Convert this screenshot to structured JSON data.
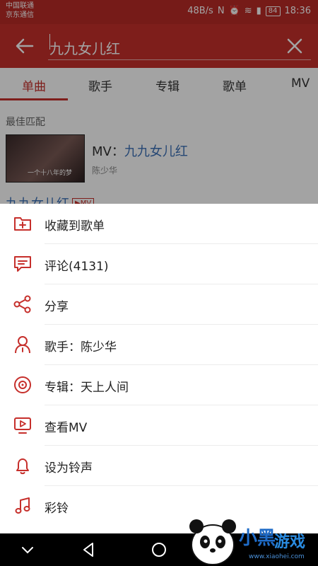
{
  "status_bar": {
    "carrier_1": "中国联通",
    "carrier_2": "京东通信",
    "network_speed": "48B/s",
    "battery": "84",
    "time": "18:36"
  },
  "search": {
    "query": "九九女儿红"
  },
  "tabs": [
    {
      "label": "单曲",
      "active": true
    },
    {
      "label": "歌手",
      "active": false
    },
    {
      "label": "专辑",
      "active": false
    },
    {
      "label": "歌单",
      "active": false
    },
    {
      "label": "MV",
      "active": false
    }
  ],
  "results": {
    "best_match_label": "最佳匹配",
    "thumbnail_caption": "一个十八年的梦",
    "mv_prefix": "MV：",
    "mv_title": "九九女儿红",
    "mv_artist": "陈少华",
    "song_title": "九九女儿红",
    "song_badge": "▶MV"
  },
  "menu": [
    {
      "label": "收藏到歌单",
      "icon": "folder-add-icon"
    },
    {
      "label": "评论(4131)",
      "icon": "comment-icon"
    },
    {
      "label": "分享",
      "icon": "share-icon"
    },
    {
      "label": "歌手：陈少华",
      "icon": "artist-icon"
    },
    {
      "label": "专辑：天上人间",
      "icon": "album-icon"
    },
    {
      "label": "查看MV",
      "icon": "mv-icon"
    },
    {
      "label": "设为铃声",
      "icon": "bell-icon"
    },
    {
      "label": "彩铃",
      "icon": "music-note-icon"
    }
  ],
  "watermark": {
    "text_1": "小黑",
    "text_2": "游戏",
    "url": "www.xiaohei.com"
  },
  "colors": {
    "accent": "#c62f2b",
    "link": "#3b6fb6"
  }
}
